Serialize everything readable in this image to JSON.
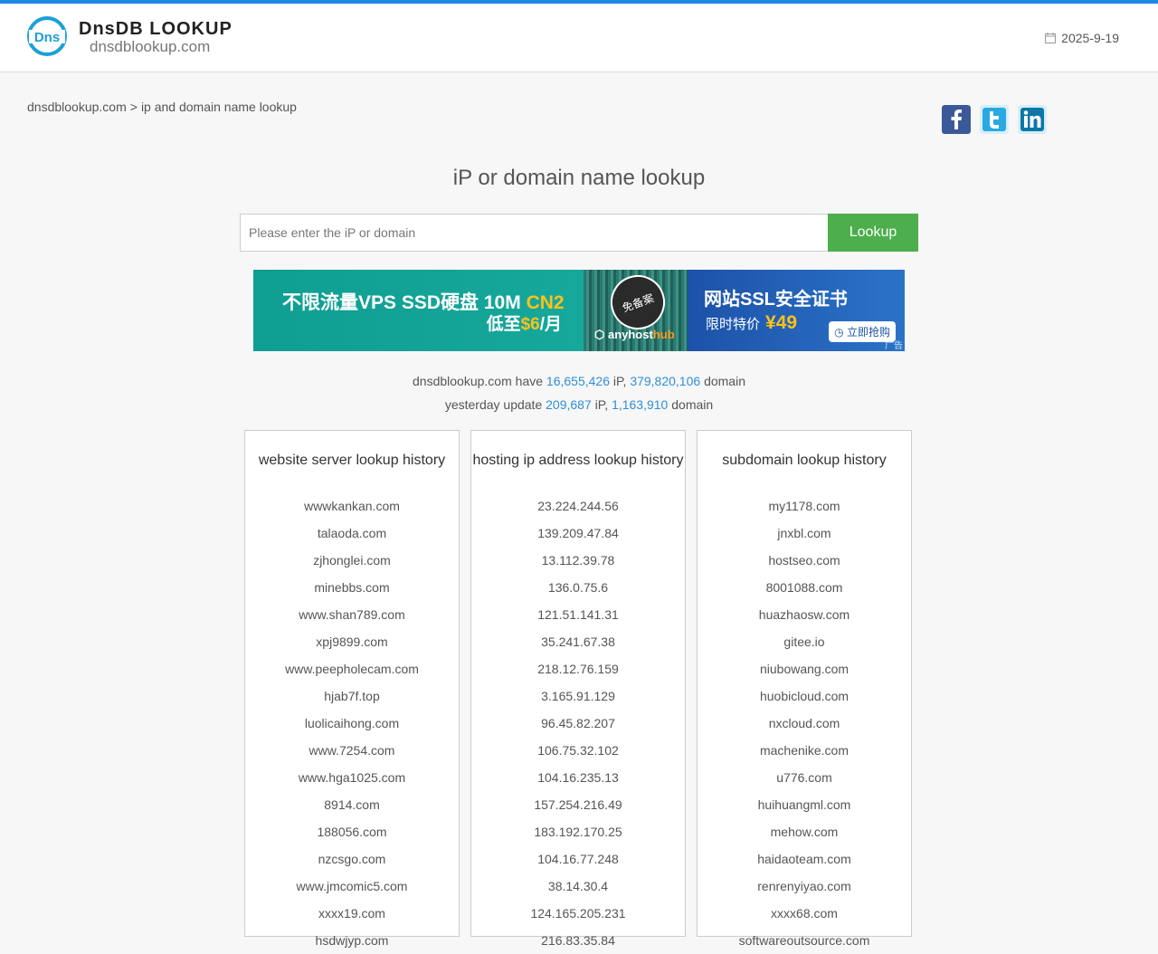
{
  "header": {
    "brand_name": "DnsDB LOOKUP",
    "brand_domain": "dnsdblookup.com",
    "date": "2025-9-19",
    "logo_text": "Dns"
  },
  "breadcrumb": {
    "home": "dnsdblookup.com",
    "separator": ">",
    "current": "ip and domain name lookup"
  },
  "social": [
    "facebook-icon",
    "twitter-icon",
    "linkedin-icon"
  ],
  "main": {
    "title": "iP or domain name lookup",
    "search_placeholder": "Please enter the iP or domain",
    "search_value": "",
    "lookup_label": "Lookup"
  },
  "banner": {
    "left_line1_a": "不限流量VPS SSD硬盘 10M ",
    "left_line1_b": "CN2",
    "left_line2_a": "低至",
    "left_line2_b": "$6",
    "left_line2_c": "/月",
    "stamp": "免备案",
    "brand_a": "anyhost",
    "brand_b": "hub",
    "right_line1": "网站SSL安全证书",
    "right_line2_a": "限时特价",
    "right_line2_b": "¥49",
    "right_button": "立即抢购",
    "ad_label": "广告"
  },
  "stats": {
    "site": "dnsdblookup.com",
    "have": "have",
    "ip_total": "16,655,426",
    "ip_unit": "iP,",
    "domain_total": "379,820,106",
    "domain_unit": "domain",
    "yesterday": "yesterday update",
    "ip_yesterday": "209,687",
    "domain_yesterday": "1,163,910"
  },
  "panels": [
    {
      "title": "website server lookup history",
      "items": [
        "wwwkankan.com",
        "talaoda.com",
        "zjhonglei.com",
        "minebbs.com",
        "www.shan789.com",
        "xpj9899.com",
        "www.peepholecam.com",
        "hjab7f.top",
        "luolicaihong.com",
        "www.7254.com",
        "www.hga1025.com",
        "8914.com",
        "188056.com",
        "nzcsgo.com",
        "www.jmcomic5.com",
        "xxxx19.com",
        "hsdwjyp.com"
      ]
    },
    {
      "title": "hosting ip address lookup history",
      "items": [
        "23.224.244.56",
        "139.209.47.84",
        "13.112.39.78",
        "136.0.75.6",
        "121.51.141.31",
        "35.241.67.38",
        "218.12.76.159",
        "3.165.91.129",
        "96.45.82.207",
        "106.75.32.102",
        "104.16.235.13",
        "157.254.216.49",
        "183.192.170.25",
        "104.16.77.248",
        "38.14.30.4",
        "124.165.205.231",
        "216.83.35.84"
      ]
    },
    {
      "title": "subdomain lookup history",
      "items": [
        "my1178.com",
        "jnxbl.com",
        "hostseo.com",
        "8001088.com",
        "huazhaosw.com",
        "gitee.io",
        "niubowang.com",
        "huobicloud.com",
        "nxcloud.com",
        "machenike.com",
        "u776.com",
        "huihuangml.com",
        "mehow.com",
        "haidaoteam.com",
        "renrenyiyao.com",
        "xxxx68.com",
        "softwareoutsource.com"
      ]
    }
  ]
}
